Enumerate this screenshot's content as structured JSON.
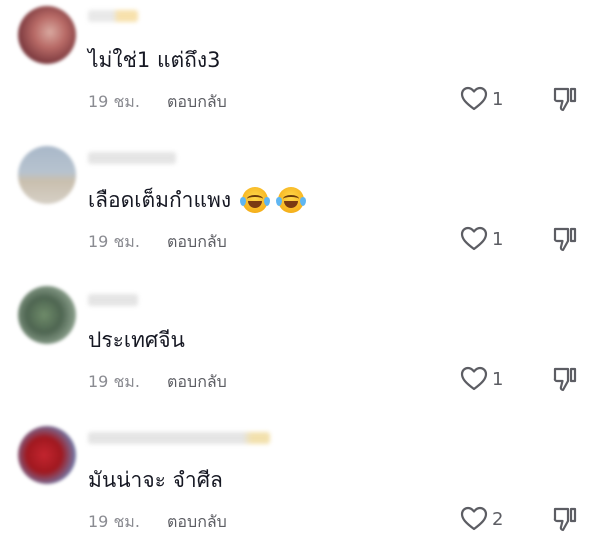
{
  "comments": [
    {
      "text": "ไม่ใช่1 แต่ถึง3",
      "time": "19 ชม.",
      "reply_label": "ตอบกลับ",
      "likes": "1",
      "emojis": []
    },
    {
      "text": "เลือดเต็มกำแพง",
      "time": "19 ชม.",
      "reply_label": "ตอบกลับ",
      "likes": "1",
      "emojis": [
        "laughing-with-tears",
        "laughing-with-tears"
      ]
    },
    {
      "text": "ประเทศจีน",
      "time": "19 ชม.",
      "reply_label": "ตอบกลับ",
      "likes": "1",
      "emojis": []
    },
    {
      "text": "มันน่าจะ จำศีล",
      "time": "19 ชม.",
      "reply_label": "ตอบกลับ",
      "likes": "2",
      "emojis": []
    }
  ],
  "icons": {
    "like": "heart-outline-icon",
    "dislike": "thumbs-down-outline-icon"
  },
  "colors": {
    "text": "#161823",
    "meta": "#8a8b91",
    "icon": "#5c5d63"
  }
}
